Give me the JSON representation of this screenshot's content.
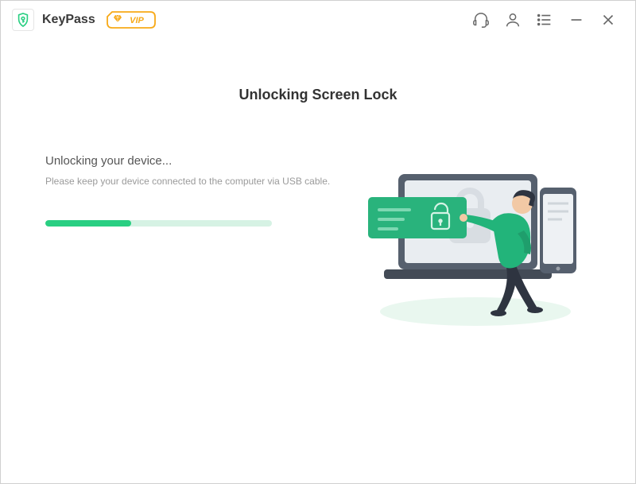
{
  "app": {
    "name": "KeyPass",
    "vip_label": "VIP"
  },
  "page": {
    "title": "Unlocking Screen Lock",
    "status": "Unlocking your device...",
    "instruction": "Please keep your device connected to the computer via USB cable.",
    "progress_percent": 38
  },
  "colors": {
    "accent": "#29cf82",
    "progress_track": "#d6f2e4",
    "vip_orange": "#f7a917",
    "text_primary": "#333333",
    "text_muted": "#9a9a9a"
  }
}
